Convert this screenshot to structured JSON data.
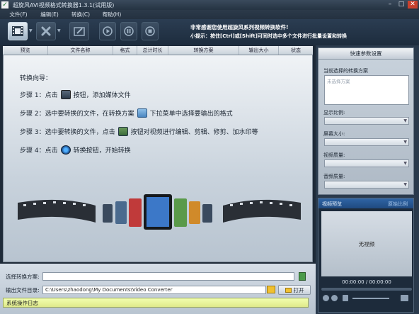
{
  "app": {
    "title": "超旋风AVI视频格式转换器1.3.1(试用版)",
    "icon": "checkmark-icon"
  },
  "window_buttons": [
    {
      "name": "minimize-button",
      "glyph": "–"
    },
    {
      "name": "maximize-button",
      "glyph": "□"
    },
    {
      "name": "close-button",
      "glyph": "✕"
    }
  ],
  "menu": [
    "文件(F)",
    "编辑(E)",
    "转换(C)",
    "帮助(H)"
  ],
  "toolbar": {
    "add_icon": "add-video-icon",
    "remove_icon": "remove-x-icon",
    "edit_icon": "edit-video-icon",
    "convert_icon": "play-icon",
    "pause_icon": "pause-icon",
    "stop_icon": "stop-icon",
    "banner_line1": "非常感谢您使用超旋风系列视频转换软件!",
    "banner_line2": "小提示：按住[Ctrl]或[Shift]可同时选中多个文件进行批量设置和转换"
  },
  "columns": [
    "预览",
    "文件名称",
    "格式",
    "总计时长",
    "转换方案",
    "输出大小",
    "状态"
  ],
  "guide": {
    "heading": "转换向导：",
    "step1_a": "步骤 1：点击",
    "step1_b": "按钮，添加媒体文件",
    "step2_a": "步骤 2：选中要转换的文件，在转换方案",
    "step2_b": "下拉菜单中选择要输出的格式",
    "step3_a": "步骤 3：选中要转换的文件，点击",
    "step3_b": "按钮对视频进行编辑、剪辑、修剪、加水印等",
    "step4_a": "步骤 4：点击",
    "step4_b": "转换按钮，开始转换"
  },
  "output": {
    "profile_label": "选择转换方案:",
    "profile_value": "",
    "dir_label": "输出文件目录:",
    "dir_value": "C:\\Users\\zhaodong\\My Documents\\Video Converter",
    "open_label": "打开",
    "log_label": "系统操作日志"
  },
  "settings": {
    "title": "快速参数设置",
    "scheme_label": "当前选择的转换方案",
    "scheme_placeholder": "未选择方案",
    "ratio_label": "显示比例:",
    "size_label": "屏幕大小:",
    "video_quality_label": "视频质量:",
    "audio_quality_label": "音频质量:"
  },
  "preview": {
    "title": "视频预览",
    "pref": "原始比例",
    "no_video": "无视频",
    "time": "00:00:00 / 00:00:00"
  },
  "colors": {
    "accent": "#2f65a5",
    "log_bar": "#eaf3a0",
    "close": "#c8412e"
  }
}
